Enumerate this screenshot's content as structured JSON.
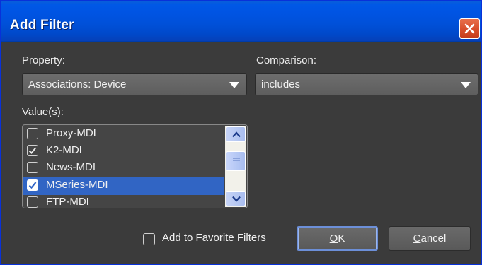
{
  "window": {
    "title": "Add Filter"
  },
  "property": {
    "label": "Property:",
    "value": "Associations: Device"
  },
  "comparison": {
    "label": "Comparison:",
    "value": "includes"
  },
  "values": {
    "label": "Value(s):",
    "items": [
      {
        "label": "Proxy-MDI",
        "checked": false,
        "selected": false
      },
      {
        "label": "K2-MDI",
        "checked": true,
        "selected": false
      },
      {
        "label": "News-MDI",
        "checked": false,
        "selected": false
      },
      {
        "label": "MSeries-MDI",
        "checked": true,
        "selected": true
      },
      {
        "label": "FTP-MDI",
        "checked": false,
        "selected": false
      }
    ]
  },
  "favorite": {
    "label": "Add to Favorite Filters",
    "checked": false
  },
  "buttons": {
    "ok_mnemonic": "O",
    "ok_rest": "K",
    "cancel_mnemonic": "C",
    "cancel_rest": "ancel"
  },
  "colors": {
    "title_bar": "#0054e3",
    "selection": "#3165c4",
    "body": "#3b3b3b"
  },
  "icons": {
    "close": "close-icon",
    "arrow": "chevron-down-icon",
    "check": "checkmark-icon"
  }
}
